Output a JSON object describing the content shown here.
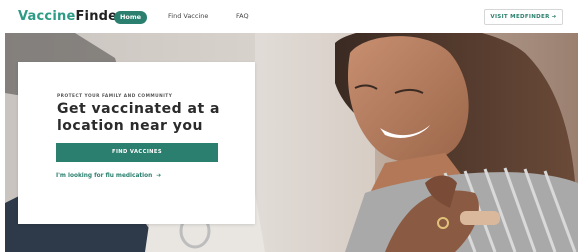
{
  "nav": {
    "logo_part1": "Vaccine",
    "logo_part2": "Finder",
    "home_label": "Home",
    "find_vaccine_label": "Find Vaccine",
    "faq_label": "FAQ",
    "visit_label": "VISIT MEDFINDER",
    "visit_arrow": "➔"
  },
  "hero": {
    "eyebrow": "PROTECT YOUR FAMILY AND COMMUNITY",
    "headline": "Get vaccinated at a location near you",
    "cta_label": "FIND VACCINES",
    "flu_link_label": "I'm looking for flu medication",
    "flu_link_arrow": "➔"
  },
  "colors": {
    "brand": "#2a7f6e",
    "brand_light": "#2d9b86"
  }
}
